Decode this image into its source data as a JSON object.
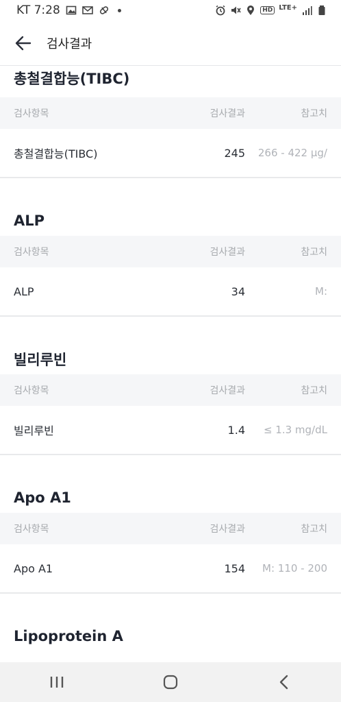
{
  "status_bar": {
    "carrier_time": "KT 7:28",
    "network": "LTE+",
    "hd": "HD"
  },
  "app_bar": {
    "title": "검사결과"
  },
  "headers": {
    "item": "검사항목",
    "result": "검사결과",
    "reference": "참고치"
  },
  "sections": [
    {
      "title": "총철결합능(TIBC)",
      "item": "총철결합능(TIBC)",
      "result": "245",
      "reference": "266 - 422 μg/"
    },
    {
      "title": "ALP",
      "item": "ALP",
      "result": "34",
      "reference": "M:"
    },
    {
      "title": "빌리루빈",
      "item": "빌리루빈",
      "result": "1.4",
      "reference": "≤ 1.3 mg/dL"
    },
    {
      "title": "Apo A1",
      "item": "Apo A1",
      "result": "154",
      "reference": "M: 110 - 200"
    },
    {
      "title": "Lipoprotein A"
    }
  ]
}
